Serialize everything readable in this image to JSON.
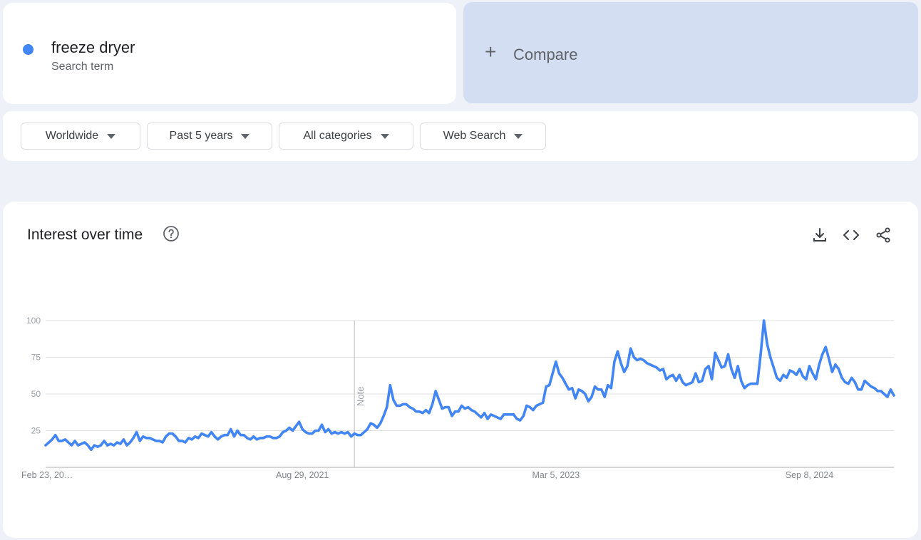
{
  "term": {
    "name": "freeze dryer",
    "subtitle": "Search term",
    "color": "#4285f4"
  },
  "compare": {
    "icon": "plus-icon",
    "plus": "+",
    "label": "Compare"
  },
  "filters": [
    {
      "label": "Worldwide"
    },
    {
      "label": "Past 5 years"
    },
    {
      "label": "All categories"
    },
    {
      "label": "Web Search"
    }
  ],
  "panel": {
    "title": "Interest over time",
    "help_icon": "help-circle-icon",
    "actions": [
      "download-icon",
      "embed-code-icon",
      "share-icon"
    ]
  },
  "chart_data": {
    "type": "line",
    "title": "Interest over time",
    "xlabel": "",
    "ylabel": "",
    "ylim": [
      0,
      100
    ],
    "yticks": [
      25,
      50,
      75,
      100
    ],
    "xtick_labels": [
      "Feb 23, 20…",
      "Aug 29, 2021",
      "Mar 5, 2023",
      "Sep 8, 2024"
    ],
    "xtick_index": [
      0,
      79,
      157,
      235
    ],
    "annotation": {
      "label": "Note",
      "index": 95
    },
    "grid": true,
    "color": "#4285f4",
    "x_frequency": "weekly",
    "x_start": "Feb 23, 2020",
    "series": [
      {
        "values": [
          15,
          17,
          19,
          22,
          18,
          18,
          19,
          17,
          15,
          18,
          15,
          16,
          17,
          15,
          12,
          15,
          14,
          15,
          18,
          15,
          16,
          15,
          17,
          16,
          19,
          15,
          17,
          20,
          24,
          18,
          21,
          20,
          20,
          19,
          18,
          18,
          17,
          21,
          23,
          23,
          21,
          18,
          18,
          17,
          20,
          19,
          21,
          20,
          23,
          22,
          21,
          24,
          21,
          19,
          21,
          22,
          22,
          26,
          21,
          25,
          22,
          22,
          20,
          19,
          21,
          19,
          20,
          20,
          21,
          21,
          20,
          20,
          21,
          24,
          25,
          27,
          25,
          28,
          31,
          26,
          24,
          23,
          23,
          25,
          25,
          29,
          24,
          26,
          23,
          24,
          23,
          24,
          23,
          24,
          21,
          23,
          22,
          22,
          24,
          26,
          30,
          29,
          27,
          30,
          35,
          41,
          56,
          46,
          42,
          42,
          43,
          43,
          41,
          40,
          38,
          38,
          37,
          39,
          37,
          43,
          52,
          46,
          40,
          41,
          41,
          35,
          38,
          38,
          42,
          40,
          41,
          39,
          38,
          36,
          34,
          37,
          33,
          36,
          35,
          34,
          33,
          36,
          36,
          36,
          36,
          33,
          32,
          35,
          42,
          41,
          39,
          42,
          43,
          44,
          55,
          56,
          64,
          72,
          64,
          61,
          57,
          53,
          54,
          47,
          53,
          52,
          50,
          45,
          48,
          55,
          53,
          53,
          48,
          56,
          54,
          72,
          79,
          71,
          65,
          69,
          81,
          75,
          73,
          74,
          73,
          71,
          70,
          69,
          68,
          66,
          67,
          60,
          62,
          63,
          59,
          63,
          58,
          56,
          57,
          58,
          64,
          58,
          59,
          67,
          69,
          60,
          78,
          73,
          68,
          69,
          77,
          67,
          61,
          69,
          59,
          54,
          56,
          57,
          57,
          57,
          77,
          100,
          84,
          75,
          68,
          61,
          59,
          63,
          61,
          66,
          65,
          63,
          67,
          62,
          60,
          69,
          64,
          60,
          70,
          77,
          82,
          74,
          65,
          70,
          67,
          61,
          58,
          57,
          61,
          58,
          53,
          53,
          59,
          57,
          55,
          54,
          52,
          52,
          50,
          48,
          53,
          49
        ]
      }
    ]
  }
}
